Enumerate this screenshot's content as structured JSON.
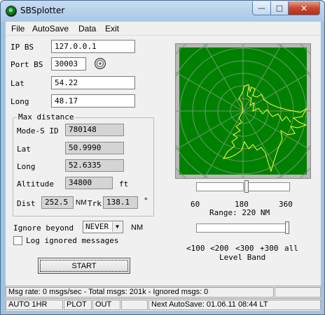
{
  "window": {
    "title": "SBSplotter",
    "minimize": "—",
    "maximize": "□",
    "close": "✕"
  },
  "menu": [
    "File",
    "AutoSave",
    "Data",
    "Exit"
  ],
  "connection": {
    "ip_label": "IP BS",
    "ip_value": "127.0.0.1",
    "port_label": "Port BS",
    "port_value": "30003"
  },
  "location": {
    "lat_label": "Lat",
    "lat_value": "54.22",
    "long_label": "Long",
    "long_value": "48.17"
  },
  "max_distance": {
    "title": "Max distance",
    "modes_label": "Mode-S ID",
    "modes_value": "780148",
    "lat_label": "Lat",
    "lat_value": "50.9990",
    "long_label": "Long",
    "long_value": "52.6335",
    "alt_label": "Altitude",
    "alt_value": "34800",
    "alt_unit": "ft",
    "dist_label": "Dist",
    "dist_value": "252.5",
    "dist_unit": "NM",
    "trk_label": "Trk",
    "trk_value": "138.1",
    "trk_unit": "°"
  },
  "range": {
    "ticks": [
      "60",
      "180",
      "360"
    ],
    "label": "Range: 220 NM"
  },
  "level_band": {
    "ticks": [
      "<100",
      "<200",
      "<300",
      "+300",
      "all"
    ],
    "label": "Level Band"
  },
  "ignore": {
    "label": "Ignore beyond",
    "value": "NEVER",
    "unit": "NM",
    "log_label": "Log ignored messages"
  },
  "start_button": "START",
  "status": {
    "msg": "Msg rate: 0 msgs/sec - Total msgs: 201k - Ignored msgs: 0",
    "autosave": "AUTO 1HR",
    "plot": "PLOT",
    "out": "OUT",
    "next": "Next AutoSave: 01.06.11 08:44 LT"
  },
  "colors": {
    "radar_bg": "#008000",
    "radar_rings": "#6a9a6a",
    "trace": "#ffff33"
  }
}
